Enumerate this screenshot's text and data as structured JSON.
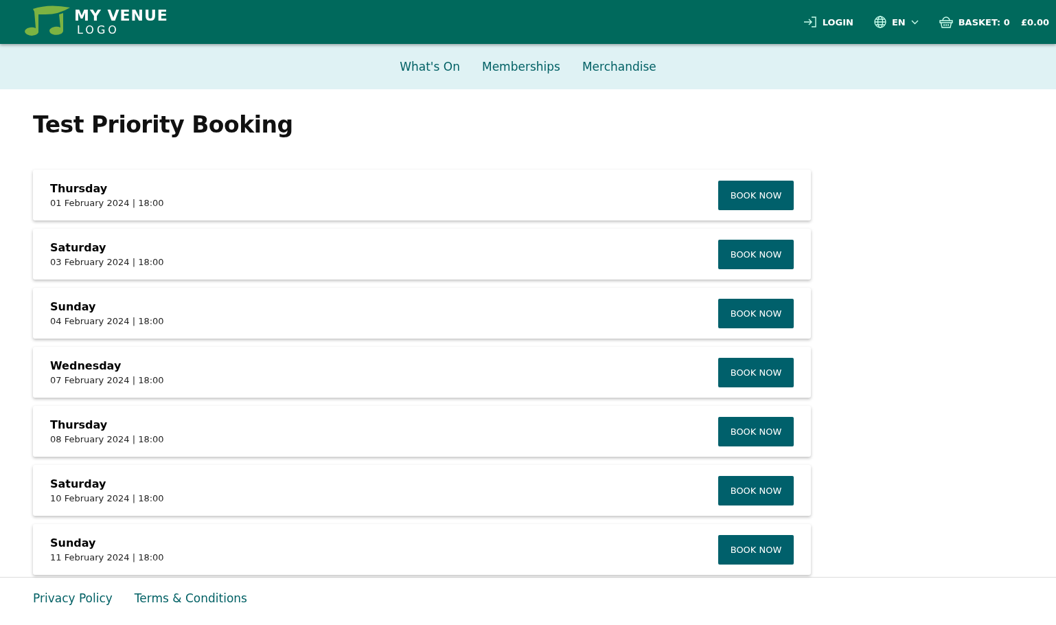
{
  "header": {
    "logo": {
      "line_1": "MY VENUE",
      "line_2": "LOGO"
    },
    "login": "LOGIN",
    "language": "EN",
    "basket": {
      "label": "BASKET: 0",
      "total": "£0.00"
    }
  },
  "nav": [
    {
      "label": "What's On"
    },
    {
      "label": "Memberships"
    },
    {
      "label": "Merchandise"
    }
  ],
  "page_title": "Test Priority Booking",
  "performances": [
    {
      "day": "Thursday",
      "date": "01 February 2024 | 18:00",
      "button": "BOOK NOW"
    },
    {
      "day": "Saturday",
      "date": "03 February 2024 | 18:00",
      "button": "BOOK NOW"
    },
    {
      "day": "Sunday",
      "date": "04 February 2024 | 18:00",
      "button": "BOOK NOW"
    },
    {
      "day": "Wednesday",
      "date": "07 February 2024 | 18:00",
      "button": "BOOK NOW"
    },
    {
      "day": "Thursday",
      "date": "08 February 2024 | 18:00",
      "button": "BOOK NOW"
    },
    {
      "day": "Saturday",
      "date": "10 February 2024 | 18:00",
      "button": "BOOK NOW"
    },
    {
      "day": "Sunday",
      "date": "11 February 2024 | 18:00",
      "button": "BOOK NOW"
    }
  ],
  "footer": {
    "links": [
      "Privacy Policy",
      "Terms & Conditions"
    ]
  }
}
